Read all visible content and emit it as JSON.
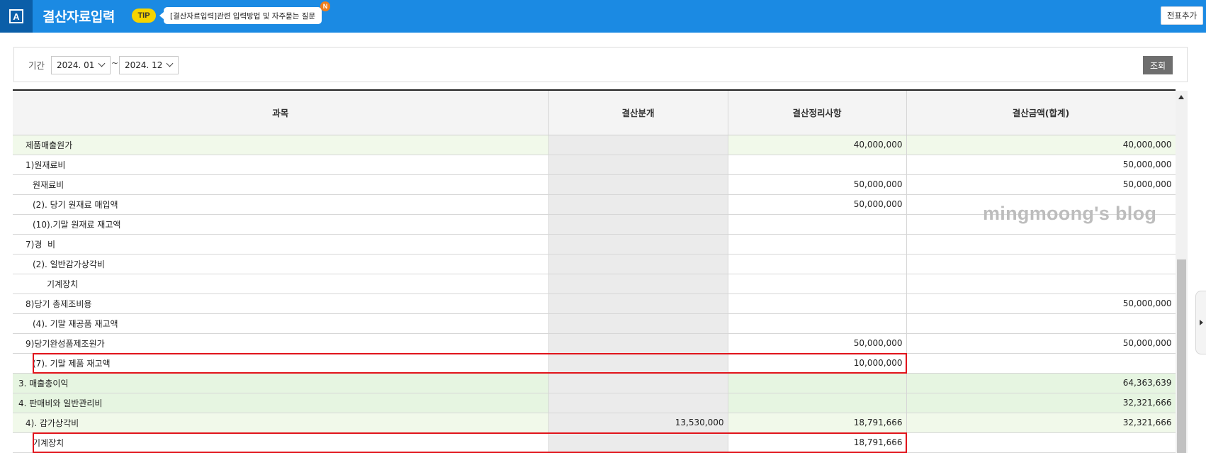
{
  "header": {
    "logo_glyph": "A",
    "title": "결산자료입력",
    "tip_badge": "TIP",
    "tip_text": "[결산자료입력]관련 입력방법 및 자주묻는 질문",
    "new_badge": "N",
    "add_voucher_button": "전표추가"
  },
  "filter": {
    "period_label": "기간",
    "from": "2024. 01",
    "separator": "~",
    "to": "2024. 12",
    "search_button": "조회"
  },
  "table": {
    "columns": [
      "과목",
      "결산분개",
      "결산정리사항",
      "결산금액(합계)"
    ],
    "rows": [
      {
        "label": "제품매출원가",
        "indent": 0,
        "entry": "",
        "adjust": "40,000,000",
        "total": "40,000,000",
        "style": "lightgreen",
        "highlight": false
      },
      {
        "label": "1)원재료비",
        "indent": 0,
        "entry": "",
        "adjust": "",
        "total": "50,000,000",
        "style": "plain",
        "highlight": false
      },
      {
        "label": "원재료비",
        "indent": 1,
        "entry": "",
        "adjust": "50,000,000",
        "total": "50,000,000",
        "style": "plain",
        "highlight": false
      },
      {
        "label": "(2). 당기 원재료 매입액",
        "indent": 1,
        "entry": "",
        "adjust": "50,000,000",
        "total": "",
        "style": "plain",
        "highlight": false
      },
      {
        "label": "(10).기말 원재료 재고액",
        "indent": 1,
        "entry": "",
        "adjust": "",
        "total": "",
        "style": "plain",
        "highlight": false
      },
      {
        "label": "7)경  비",
        "indent": 0,
        "entry": "",
        "adjust": "",
        "total": "",
        "style": "plain",
        "highlight": false
      },
      {
        "label": "(2). 일반감가상각비",
        "indent": 1,
        "entry": "",
        "adjust": "",
        "total": "",
        "style": "plain",
        "highlight": false
      },
      {
        "label": "기계장치",
        "indent": 2,
        "entry": "",
        "adjust": "",
        "total": "",
        "style": "plain",
        "highlight": false
      },
      {
        "label": "8)당기 총제조비용",
        "indent": 0,
        "entry": "",
        "adjust": "",
        "total": "50,000,000",
        "style": "plain",
        "highlight": false
      },
      {
        "label": "(4). 기말 재공품 재고액",
        "indent": 1,
        "entry": "",
        "adjust": "",
        "total": "",
        "style": "plain",
        "highlight": false
      },
      {
        "label": "9)당기완성품제조원가",
        "indent": 0,
        "entry": "",
        "adjust": "50,000,000",
        "total": "50,000,000",
        "style": "plain",
        "highlight": false
      },
      {
        "label": "(7). 기말 제품 재고액",
        "indent": 1,
        "entry": "",
        "adjust": "10,000,000",
        "total": "",
        "style": "plain",
        "highlight": true
      },
      {
        "label": "3. 매출총이익",
        "indent": -1,
        "entry": "",
        "adjust": "",
        "total": "64,363,639",
        "style": "green",
        "highlight": false
      },
      {
        "label": "4. 판매비와 일반관리비",
        "indent": -1,
        "entry": "",
        "adjust": "",
        "total": "32,321,666",
        "style": "green",
        "highlight": false
      },
      {
        "label": "4). 감가상각비",
        "indent": 0,
        "entry": "13,530,000",
        "adjust": "18,791,666",
        "total": "32,321,666",
        "style": "lightgreen",
        "highlight": false
      },
      {
        "label": "기계장치",
        "indent": 1,
        "entry": "",
        "adjust": "18,791,666",
        "total": "",
        "style": "plain",
        "highlight": true
      }
    ]
  },
  "watermark": "mingmoong's blog",
  "colors": {
    "header_bg": "#1b8ae3",
    "logo_bg": "#0b5ea8",
    "highlight_border": "#e1141b",
    "row_lightgreen": "#f1f9ea",
    "row_green": "#e6f5e1"
  }
}
